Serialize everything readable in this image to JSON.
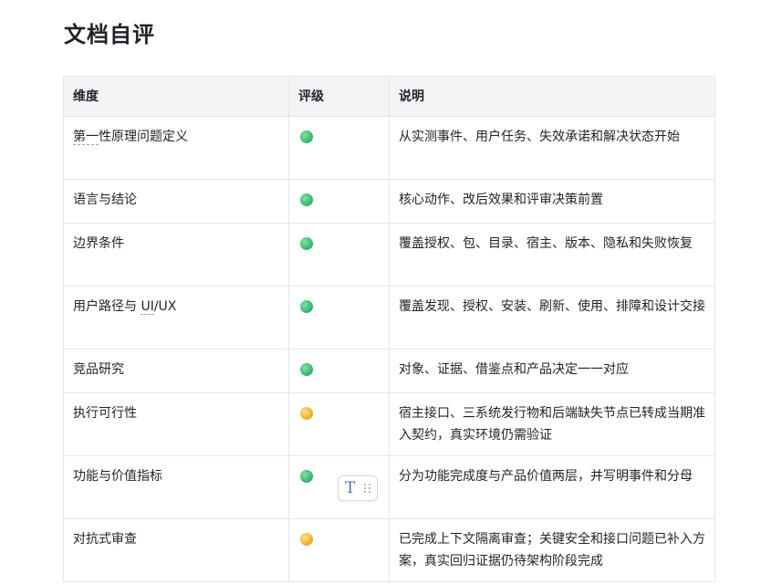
{
  "page": {
    "title": "文档自评"
  },
  "table": {
    "headers": [
      "维度",
      "评级",
      "说明"
    ],
    "rows": [
      {
        "dimension_a": "第一",
        "dimension_b": "性原理问题定义",
        "rating": "green",
        "description": "从实测事件、用户任务、失效承诺和解决状态开始"
      },
      {
        "dimension": "语言与结论",
        "rating": "green",
        "description": "核心动作、改后效果和评审决策前置"
      },
      {
        "dimension": "边界条件",
        "rating": "green",
        "description": "覆盖授权、包、目录、宿主、版本、隐私和失败恢复"
      },
      {
        "dimension_a": "用户路径与 ",
        "dimension_b": "UI",
        "dimension_c": "/UX",
        "rating": "green",
        "description": "覆盖发现、授权、安装、刷新、使用、排障和设计交接"
      },
      {
        "dimension": "竞品研究",
        "rating": "green",
        "description": "对象、证据、借鉴点和产品决定一一对应"
      },
      {
        "dimension": "执行可行性",
        "rating": "yellow",
        "description": "宿主接口、三系统发行物和后端缺失节点已转成当期准入契约，真实环境仍需验证"
      },
      {
        "dimension": "功能与价值指标",
        "rating": "green",
        "description": "分为功能完成度与产品价值两层，并写明事件和分母"
      },
      {
        "dimension": "对抗式审查",
        "rating": "yellow",
        "description": "已完成上下文隔离审查；关键安全和接口问题已补入方案，真实回归证据仍待架构阶段完成"
      }
    ]
  },
  "colors": {
    "green": "#3cbf74",
    "yellow": "#f2b734",
    "header_bg": "#f3f4f6",
    "border": "#e3e6ea",
    "tool_icon": "#4a76c9"
  },
  "floating_toolbar": {
    "icons": [
      "text-format-icon",
      "drag-handle-icon"
    ]
  }
}
